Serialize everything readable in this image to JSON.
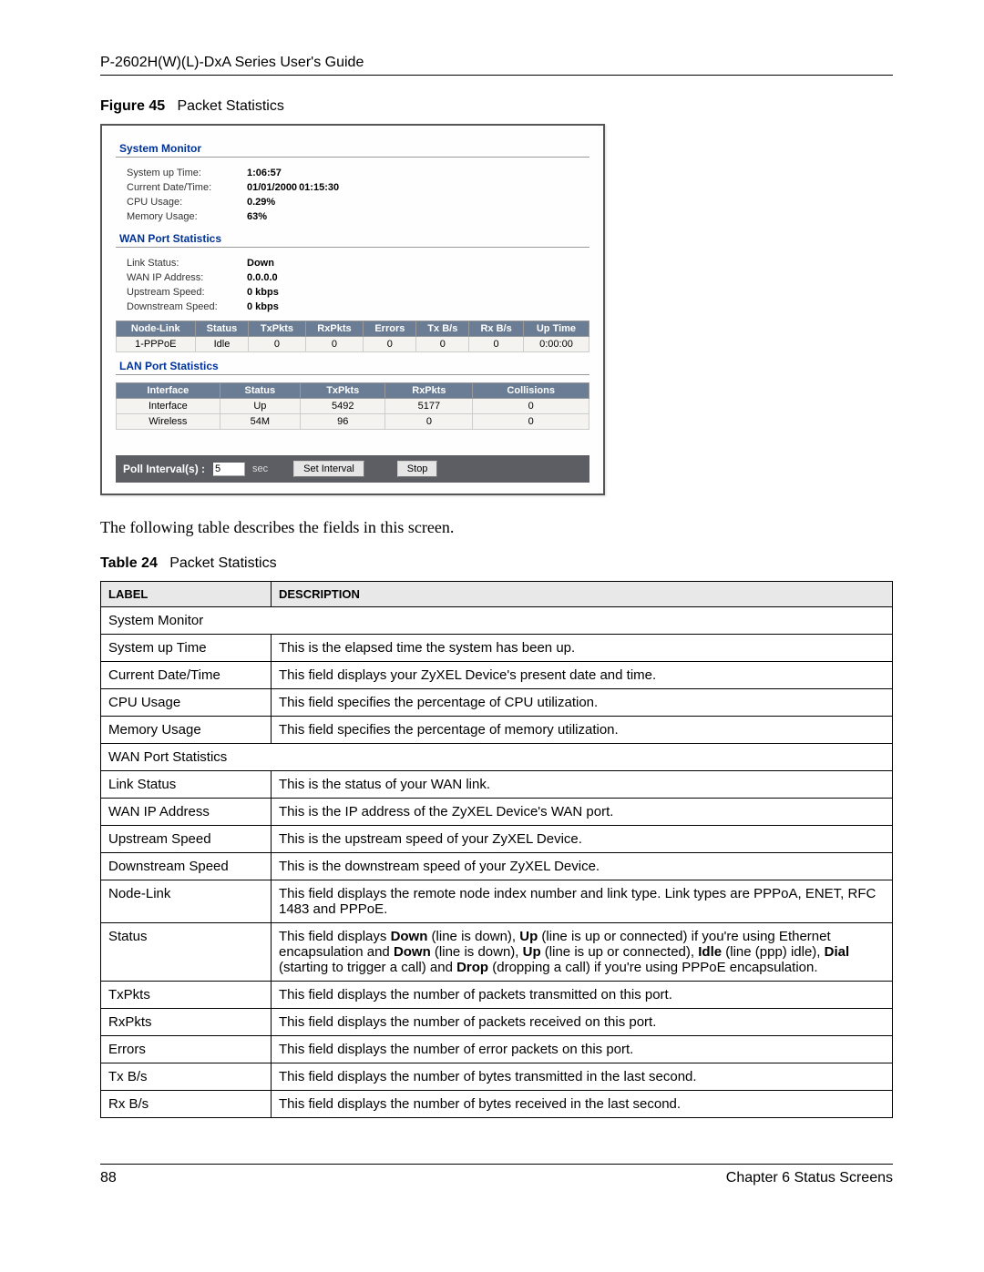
{
  "header": {
    "title": "P-2602H(W)(L)-DxA Series User's Guide"
  },
  "figure": {
    "label": "Figure 45",
    "title": "Packet Statistics"
  },
  "screenshot": {
    "system_monitor": {
      "heading": "System Monitor",
      "rows": [
        {
          "label": "System up Time:",
          "value": "1:06:57"
        },
        {
          "label": "Current Date/Time:",
          "value": "01/01/2000",
          "extra": "01:15:30"
        },
        {
          "label": "CPU Usage:",
          "value": "0.29%"
        },
        {
          "label": "Memory Usage:",
          "value": "63%"
        }
      ]
    },
    "wan_port": {
      "heading": "WAN Port Statistics",
      "rows": [
        {
          "label": "Link Status:",
          "value": "Down"
        },
        {
          "label": "WAN IP Address:",
          "value": "0.0.0.0"
        },
        {
          "label": "Upstream Speed:",
          "value": "0 kbps"
        },
        {
          "label": "Downstream Speed:",
          "value": "0 kbps"
        }
      ],
      "grid": {
        "headers": [
          "Node-Link",
          "Status",
          "TxPkts",
          "RxPkts",
          "Errors",
          "Tx B/s",
          "Rx B/s",
          "Up Time"
        ],
        "row": [
          "1-PPPoE",
          "Idle",
          "0",
          "0",
          "0",
          "0",
          "0",
          "0:00:00"
        ]
      }
    },
    "lan_port": {
      "heading": "LAN Port Statistics",
      "grid": {
        "headers": [
          "Interface",
          "Status",
          "TxPkts",
          "RxPkts",
          "Collisions"
        ],
        "rows": [
          [
            "Interface",
            "Up",
            "5492",
            "5177",
            "0"
          ],
          [
            "Wireless",
            "54M",
            "96",
            "0",
            "0"
          ]
        ]
      }
    },
    "poll": {
      "label": "Poll Interval(s) :",
      "value": "5",
      "unit": "sec",
      "set_btn": "Set Interval",
      "stop_btn": "Stop"
    }
  },
  "body_text": "The following table describes the fields in this screen.",
  "table_caption": {
    "label": "Table 24",
    "title": "Packet Statistics"
  },
  "desc_table": {
    "header_label": "Label",
    "header_desc": "Description",
    "rows": [
      {
        "label": "System Monitor",
        "desc": "",
        "span": true
      },
      {
        "label": "System up Time",
        "desc": "This is the elapsed time the system has been up."
      },
      {
        "label": "Current Date/Time",
        "desc": "This field displays your ZyXEL Device's present date and time."
      },
      {
        "label": "CPU Usage",
        "desc": "This field specifies the percentage of CPU utilization."
      },
      {
        "label": "Memory Usage",
        "desc": "This field specifies the percentage of memory utilization."
      },
      {
        "label": "WAN Port Statistics",
        "desc": "",
        "span": true
      },
      {
        "label": "Link Status",
        "desc": "This is the status of your WAN link."
      },
      {
        "label": "WAN IP Address",
        "desc": "This is the IP address of the ZyXEL Device's WAN port."
      },
      {
        "label": "Upstream Speed",
        "desc": "This is the upstream speed of your ZyXEL Device."
      },
      {
        "label": "Downstream Speed",
        "desc": "This is the downstream speed of your ZyXEL Device."
      },
      {
        "label": "Node-Link",
        "desc": "This field displays the remote node index number and link type. Link types are PPPoA, ENET, RFC 1483 and PPPoE."
      },
      {
        "label": "Status",
        "desc_html": "This field displays <b>Down</b> (line is down), <b>Up</b> (line is up or connected) if you're using Ethernet encapsulation and <b>Down</b> (line is down), <b>Up</b> (line is up or connected), <b>Idle</b> (line (ppp) idle), <b>Dial</b> (starting to trigger a call) and <b>Drop</b> (dropping a call) if you're using PPPoE encapsulation."
      },
      {
        "label": "TxPkts",
        "desc": "This field displays the number of packets transmitted on this port."
      },
      {
        "label": "RxPkts",
        "desc": "This field displays the number of packets received on this port."
      },
      {
        "label": "Errors",
        "desc": "This field displays the number of error packets on this port."
      },
      {
        "label": "Tx B/s",
        "desc": "This field displays the number of bytes transmitted in the last second."
      },
      {
        "label": "Rx B/s",
        "desc": "This field displays the number of bytes received in the last second."
      }
    ]
  },
  "footer": {
    "page": "88",
    "chapter": "Chapter 6 Status Screens"
  }
}
